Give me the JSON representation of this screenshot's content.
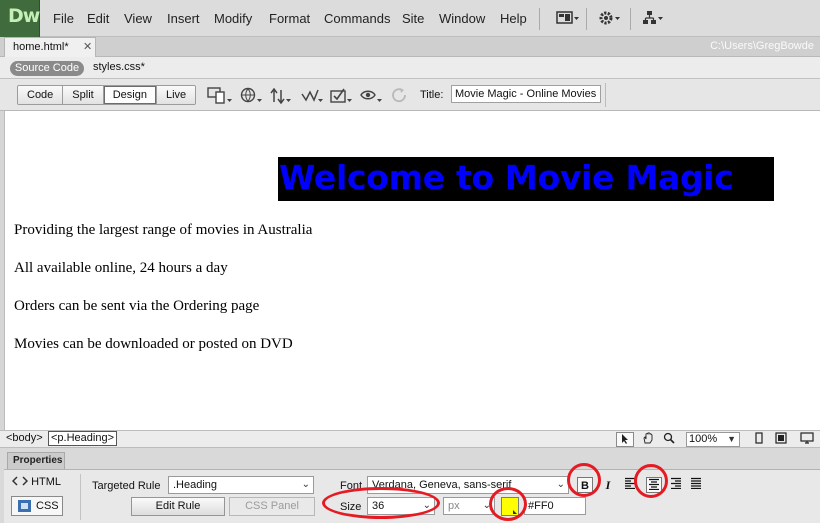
{
  "app": {
    "logo_text": "Dw"
  },
  "menu": [
    "File",
    "Edit",
    "View",
    "Insert",
    "Modify",
    "Format",
    "Commands",
    "Site",
    "Window",
    "Help"
  ],
  "document": {
    "tab_label": "home.html*",
    "close_glyph": "✕",
    "path_text": "C:\\Users\\GregBowde",
    "source_code_label": "Source Code",
    "related_file": "styles.css*"
  },
  "toolbar": {
    "views": [
      "Code",
      "Split",
      "Design",
      "Live"
    ],
    "active_view": "Design",
    "title_label": "Title:",
    "title_value": "Movie Magic - Online Movies"
  },
  "page": {
    "heading": "Welcome to Movie Magic",
    "paragraphs": [
      "Providing the largest range of movies in Australia",
      "All available online, 24 hours a day",
      "Orders can be sent via the Ordering page",
      "Movies can be downloaded or posted on DVD"
    ],
    "heading_bg": "#000000",
    "heading_color": "#0000ff"
  },
  "status": {
    "tag_body": "<body>",
    "tag_p": "<p.Heading>",
    "zoom": "100%"
  },
  "properties": {
    "tab_label": "Properties",
    "html_label": "HTML",
    "css_label": "CSS",
    "targeted_rule_label": "Targeted Rule",
    "targeted_rule_value": ".Heading",
    "edit_rule_label": "Edit Rule",
    "css_panel_label": "CSS Panel",
    "font_label": "Font",
    "font_value": "Verdana, Geneva, sans-serif",
    "size_label": "Size",
    "size_value": "36",
    "unit_value": "px",
    "color_value": "#FF0",
    "color_swatch": "#ffff00",
    "bold_glyph": "B",
    "italic_glyph": "I"
  },
  "annotation_color": "#e51b24"
}
